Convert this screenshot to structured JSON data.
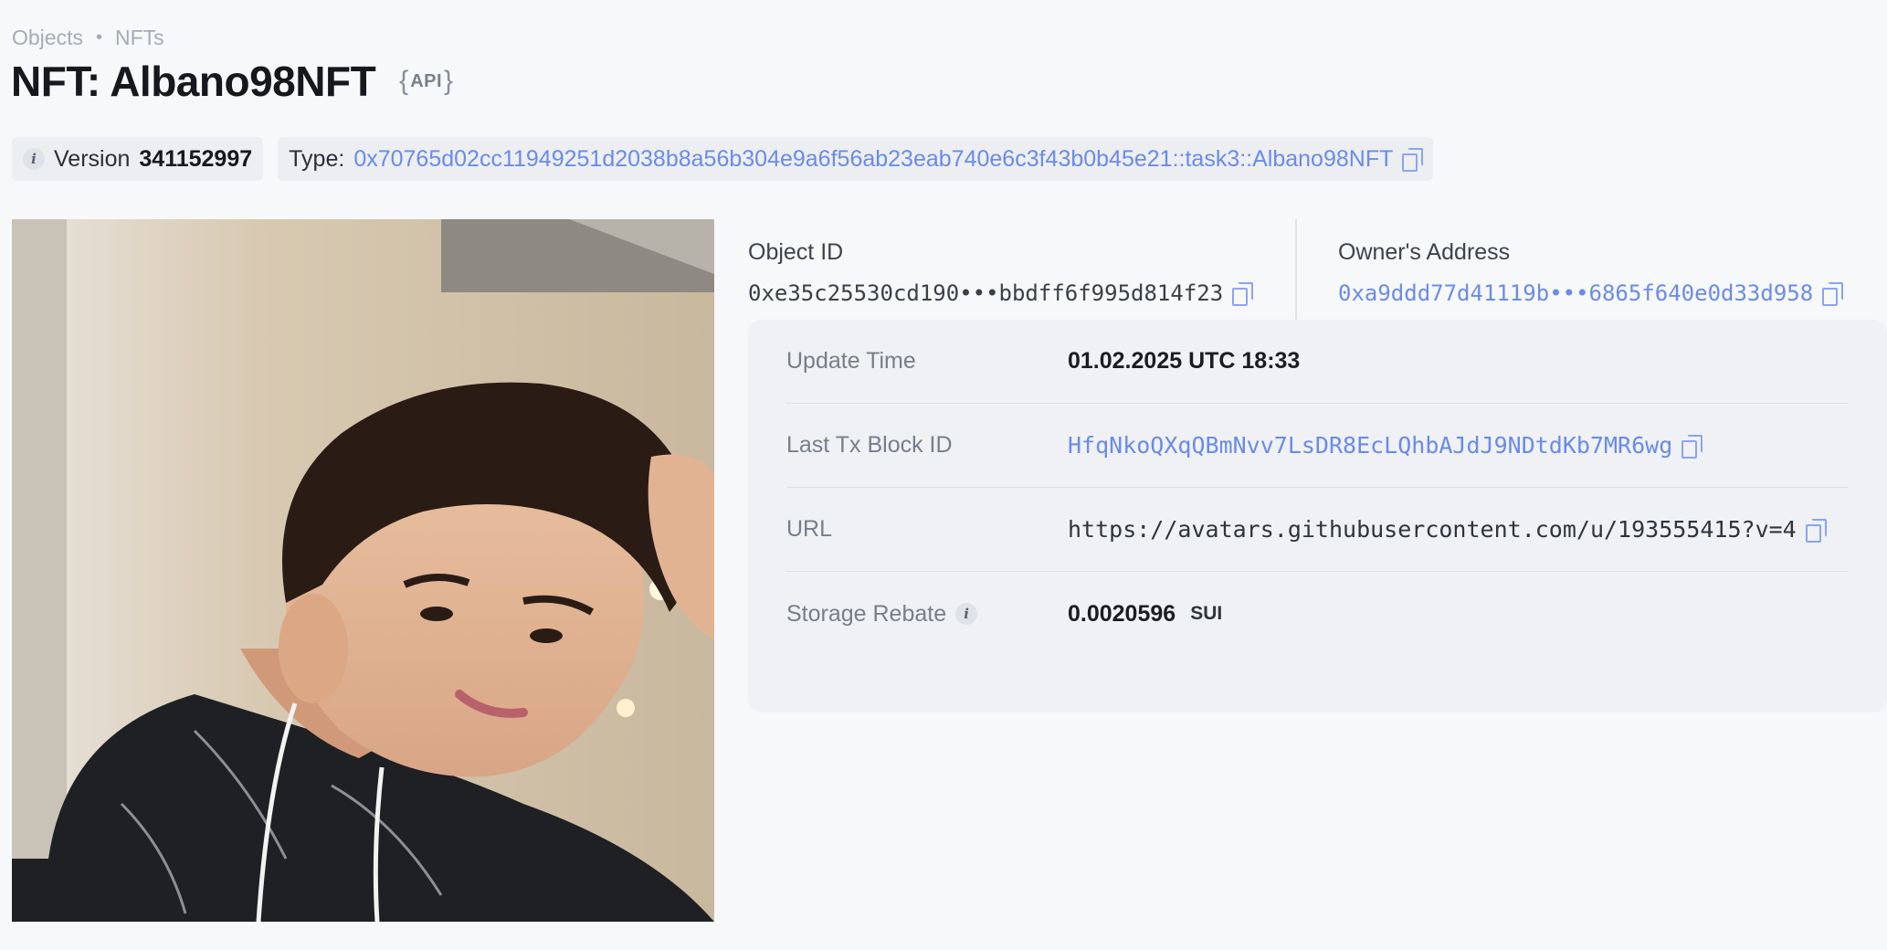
{
  "breadcrumb": {
    "items": [
      "Objects",
      "NFTs"
    ],
    "separator": "•"
  },
  "header": {
    "title": "NFT: Albano98NFT",
    "api_badge": "API"
  },
  "meta": {
    "version_label": "Version",
    "version_value": "341152997",
    "type_label": "Type:",
    "type_value": "0x70765d02cc11949251d2038b8a56b304e9a6f56ab23eab740e6c3f43b0b45e21::task3::Albano98NFT"
  },
  "object_id": {
    "label": "Object ID",
    "value": "0xe35c25530cd190•••bbdff6f995d814f23"
  },
  "owner": {
    "label": "Owner's Address",
    "value": "0xa9ddd77d41119b•••6865f640e0d33d958"
  },
  "details": {
    "update_time_label": "Update Time",
    "update_time_value": "01.02.2025 UTC 18:33",
    "last_tx_label": "Last Tx Block ID",
    "last_tx_value": "HfqNkoQXqQBmNvv7LsDR8EcLQhbAJdJ9NDtdKb7MR6wg",
    "url_label": "URL",
    "url_value": "https://avatars.githubusercontent.com/u/193555415?v=4",
    "storage_label": "Storage Rebate",
    "storage_value": "0.0020596",
    "storage_unit": "SUI"
  },
  "colors": {
    "link": "#6a8be8",
    "background": "#f7f8fa",
    "card": "#eff1f5"
  },
  "icons": [
    "info-icon",
    "copy-icon"
  ]
}
